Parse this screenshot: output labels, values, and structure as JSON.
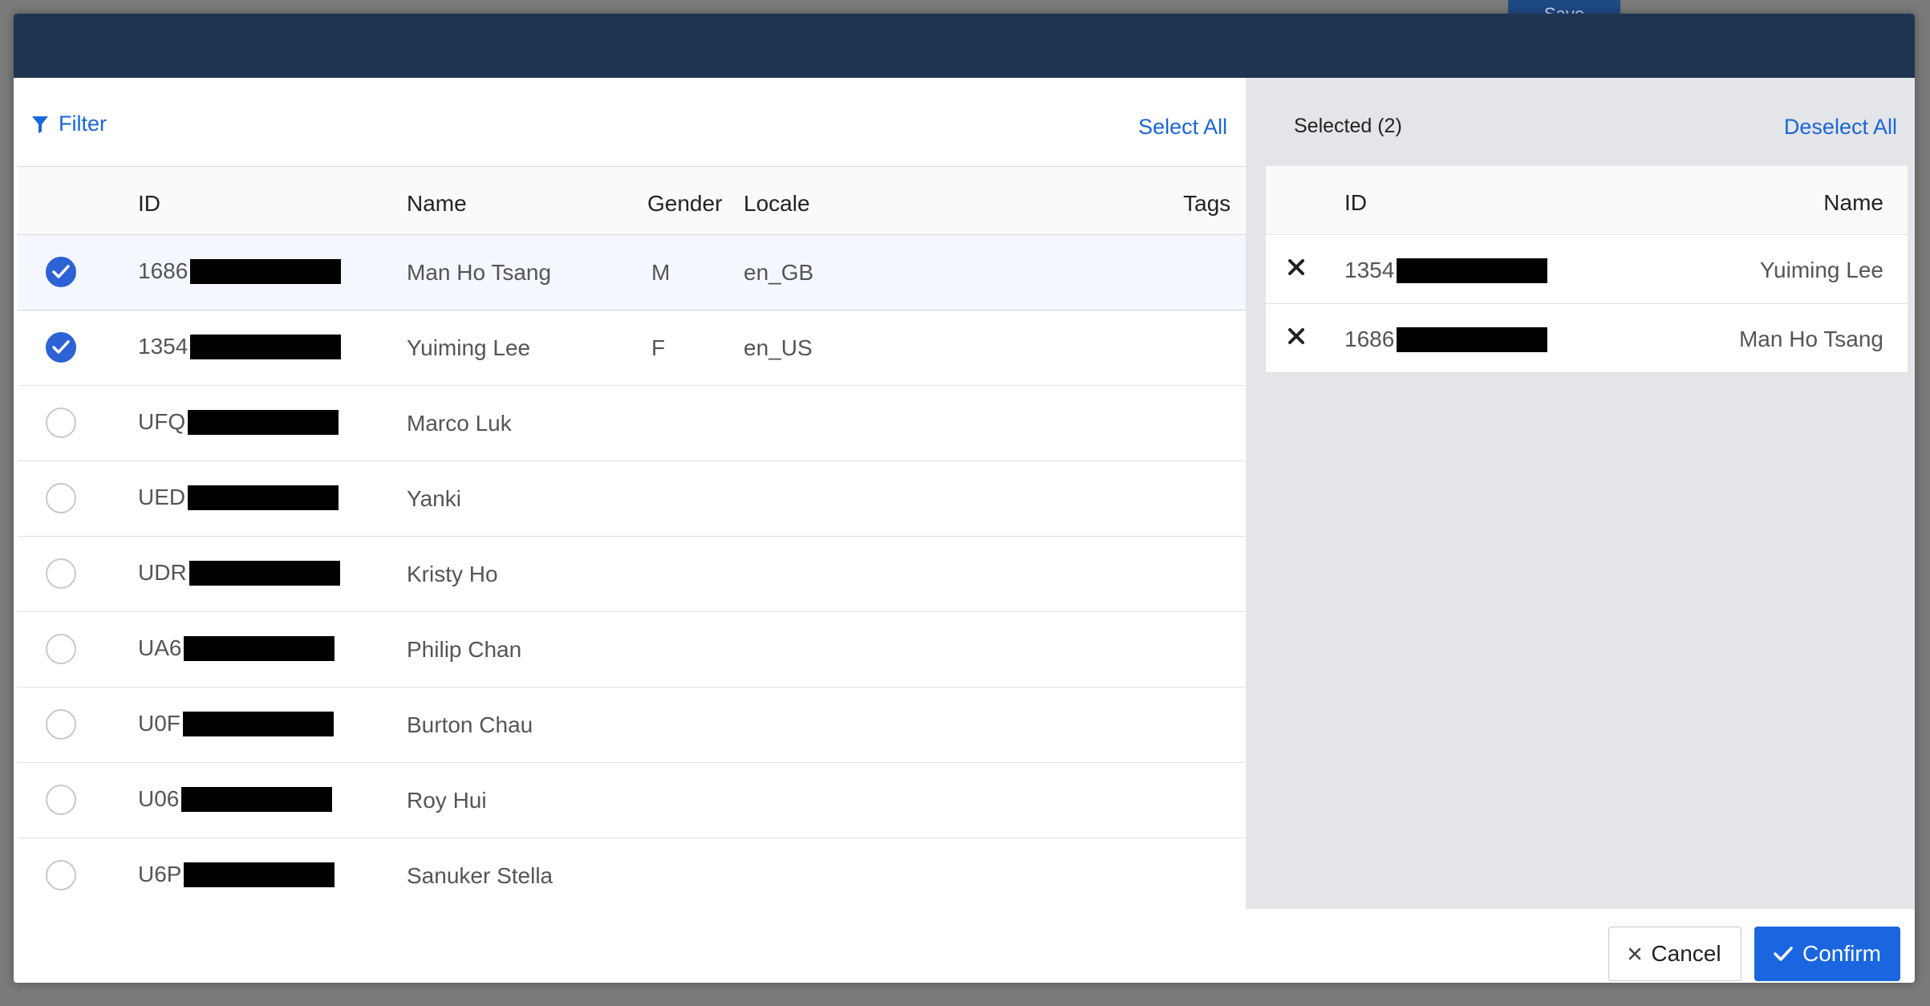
{
  "background": {
    "save_label": "Save"
  },
  "toolbar": {
    "filter_label": "Filter",
    "select_all_label": "Select All"
  },
  "table": {
    "columns": {
      "id": "ID",
      "name": "Name",
      "gender": "Gender",
      "locale": "Locale",
      "tags": "Tags"
    },
    "rows": [
      {
        "id_prefix": "1686",
        "name": "Man Ho Tsang",
        "gender": "M",
        "locale": "en_GB",
        "checked": true
      },
      {
        "id_prefix": "1354",
        "name": "Yuiming Lee",
        "gender": "F",
        "locale": "en_US",
        "checked": true
      },
      {
        "id_prefix": "UFQ",
        "name": "Marco Luk",
        "gender": "",
        "locale": "",
        "checked": false
      },
      {
        "id_prefix": "UED",
        "name": "Yanki",
        "gender": "",
        "locale": "",
        "checked": false
      },
      {
        "id_prefix": "UDR",
        "name": "Kristy Ho",
        "gender": "",
        "locale": "",
        "checked": false
      },
      {
        "id_prefix": "UA6",
        "name": "Philip Chan",
        "gender": "",
        "locale": "",
        "checked": false
      },
      {
        "id_prefix": "U0F",
        "name": "Burton Chau",
        "gender": "",
        "locale": "",
        "checked": false
      },
      {
        "id_prefix": "U06",
        "name": "Roy Hui",
        "gender": "",
        "locale": "",
        "checked": false
      },
      {
        "id_prefix": "U6P",
        "name": "Sanuker Stella",
        "gender": "",
        "locale": "",
        "checked": false
      }
    ]
  },
  "selected_panel": {
    "title": "Selected (2)",
    "deselect_all_label": "Deselect All",
    "columns": {
      "id": "ID",
      "name": "Name"
    },
    "rows": [
      {
        "id_prefix": "1354",
        "name": "Yuiming Lee"
      },
      {
        "id_prefix": "1686",
        "name": "Man Ho Tsang"
      }
    ]
  },
  "footer": {
    "cancel_label": "Cancel",
    "confirm_label": "Confirm"
  },
  "colors": {
    "header": "#1e3552",
    "accent": "#1a66e0",
    "link": "#1a66d9",
    "check": "#2c62d6"
  }
}
